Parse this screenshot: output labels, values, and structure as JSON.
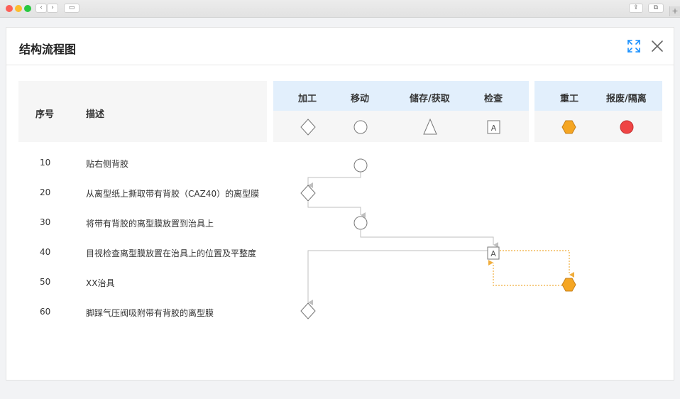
{
  "dialog": {
    "title": "结构流程图",
    "expand_icon": "expand-arrows-icon",
    "close_icon": "close-x-icon"
  },
  "columns": {
    "seq": "序号",
    "desc": "描述",
    "process": "加工",
    "move": "移动",
    "store": "储存/获取",
    "inspect": "检查",
    "rework": "重工",
    "scrap": "报废/隔离"
  },
  "legend": {
    "process_icon": "diamond-icon",
    "move_icon": "circle-icon",
    "store_icon": "triangle-icon",
    "inspect_icon": "square-a-icon",
    "inspect_letter": "A",
    "rework_icon": "orange-hexagon-icon",
    "scrap_icon": "red-circle-icon"
  },
  "rows": [
    {
      "seq": "10",
      "desc": "贴右侧背胶",
      "type": "move"
    },
    {
      "seq": "20",
      "desc": "从离型纸上撕取带有背胶（CAZ40）的离型膜",
      "type": "process"
    },
    {
      "seq": "30",
      "desc": "将带有背胶的离型膜放置到治具上",
      "type": "move"
    },
    {
      "seq": "40",
      "desc": "目视检查离型膜放置在治具上的位置及平整度",
      "type": "inspect"
    },
    {
      "seq": "50",
      "desc": "XX治具",
      "type": "rework"
    },
    {
      "seq": "60",
      "desc": "脚踩气压阀吸附带有背胶的离型膜",
      "type": "process"
    }
  ],
  "colors": {
    "header_blue": "#e2effc",
    "header_grey": "#f6f6f6",
    "flow_line": "#bfbfbf",
    "rework_line": "#f0ad3c",
    "rework_fill": "#f5a623",
    "scrap_fill": "#ef4545",
    "accent": "#1890ff"
  }
}
